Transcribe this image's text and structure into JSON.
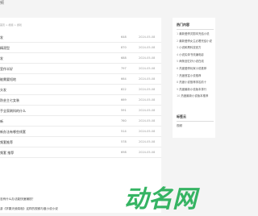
{
  "page": {
    "title": "频"
  },
  "breadcrumb": "首页 > 视频 > 游戏",
  "articles": [
    {
      "title": "发",
      "views": "648",
      "date": "2024-05-08"
    },
    {
      "title": "精湛型",
      "views": "870",
      "date": "2024-05-08"
    },
    {
      "title": "发",
      "views": "688",
      "date": "2024-05-08"
    },
    {
      "title": "室作半好",
      "views": "797",
      "date": "2024-05-08"
    },
    {
      "title": "能需要短地",
      "views": "664",
      "date": "2024-05-08"
    },
    {
      "title": "头发",
      "views": "822",
      "date": "2024-05-08"
    },
    {
      "title": "防芸主七女装",
      "views": "669",
      "date": "2024-05-08"
    },
    {
      "title": "手全家刷科的什么",
      "views": "591",
      "date": "2024-05-08"
    },
    {
      "title": "新",
      "views": "760",
      "date": "2024-05-08"
    },
    {
      "title": "新办法有哪些线套",
      "views": "514",
      "date": "2024-05-08"
    },
    {
      "title": "频套推荐",
      "views": "578",
      "date": "2024-05-08"
    },
    {
      "title": "频套 推荐",
      "views": "698",
      "date": "2024-05-08"
    }
  ],
  "text_lines": [
    "没有什么办法能快速赚钱？",
    "游《学霸天使真相》这样的视频与做小说小说",
    "游《明子和豪子》这样的视频与做小说小说"
  ],
  "sidebar": {
    "hot_heading": "热门内容",
    "hot_items": [
      {
        "num": "1",
        "label": "最新爱情灵剧本完结小说"
      },
      {
        "num": "2",
        "label": "最新爱情女主必看完结小说"
      },
      {
        "num": "3",
        "label": "小说和黑科技官方"
      },
      {
        "num": "4",
        "label": "小说实体书改编电影"
      },
      {
        "num": "5",
        "label": "两条回忆好小说在线"
      },
      {
        "num": "6",
        "label": "热度爱情玩家小说推荐"
      },
      {
        "num": "7",
        "label": "热度首富小说推荐"
      },
      {
        "num": "8",
        "label": "热度小说推荐排名前十"
      },
      {
        "num": "9",
        "label": "热度最新小说版本排行"
      },
      {
        "num": "10",
        "label": "热度最新小说版本推荐"
      }
    ],
    "tag_heading": "标签云",
    "tag_link": "视频"
  },
  "watermark": {
    "text": "动名网",
    "color": "#2bb05b"
  }
}
